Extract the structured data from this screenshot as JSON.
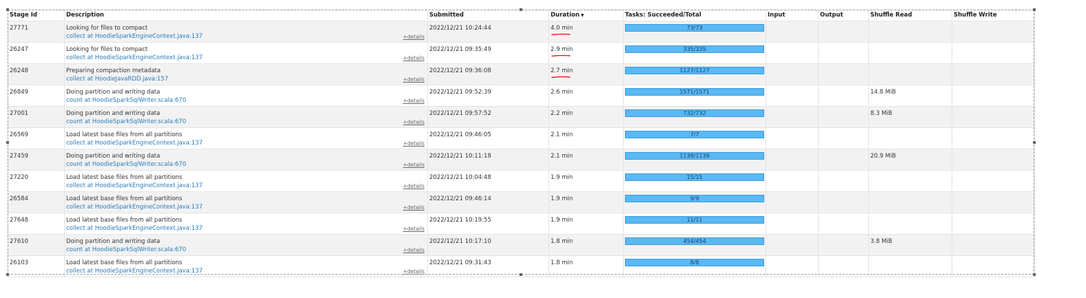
{
  "columns": {
    "stage_id": "Stage Id",
    "description": "Description",
    "submitted": "Submitted",
    "duration": "Duration",
    "duration_sort_icon": "sort-down-icon",
    "tasks": "Tasks: Succeeded/Total",
    "input": "Input",
    "output": "Output",
    "shuffle_read": "Shuffle Read",
    "shuffle_write": "Shuffle Write"
  },
  "details_label": "+details",
  "colors": {
    "link": "#2a7ab9",
    "bar": "#5ab8f5",
    "annotation": "#e02020"
  },
  "rows": [
    {
      "id": "27771",
      "desc": "Looking for files to compact",
      "link": "collect at HoodieSparkEngineContext.java:137",
      "submitted": "2022/12/21 10:24:44",
      "duration": "4.0 min",
      "tasks": "73/73",
      "tasks_fraction": 1,
      "input": "",
      "output": "",
      "shuffle_read": "",
      "shuffle_write": "",
      "underlined": true
    },
    {
      "id": "26247",
      "desc": "Looking for files to compact",
      "link": "collect at HoodieSparkEngineContext.java:137",
      "submitted": "2022/12/21 09:35:49",
      "duration": "2.9 min",
      "tasks": "335/335",
      "tasks_fraction": 1,
      "input": "",
      "output": "",
      "shuffle_read": "",
      "shuffle_write": "",
      "underlined": true
    },
    {
      "id": "26248",
      "desc": "Preparing compaction metadata",
      "link": "collect at HoodieJavaRDD.java:157",
      "submitted": "2022/12/21 09:36:08",
      "duration": "2.7 min",
      "tasks": "1127/1127",
      "tasks_fraction": 1,
      "input": "",
      "output": "",
      "shuffle_read": "",
      "shuffle_write": "",
      "underlined": true
    },
    {
      "id": "26849",
      "desc": "Doing partition and writing data",
      "link": "count at HoodieSparkSqlWriter.scala:670",
      "submitted": "2022/12/21 09:52:39",
      "duration": "2.6 min",
      "tasks": "1571/1571",
      "tasks_fraction": 1,
      "input": "",
      "output": "",
      "shuffle_read": "14.8 MiB",
      "shuffle_write": "",
      "underlined": false
    },
    {
      "id": "27001",
      "desc": "Doing partition and writing data",
      "link": "count at HoodieSparkSqlWriter.scala:670",
      "submitted": "2022/12/21 09:57:52",
      "duration": "2.2 min",
      "tasks": "732/732",
      "tasks_fraction": 1,
      "input": "",
      "output": "",
      "shuffle_read": "8.3 MiB",
      "shuffle_write": "",
      "underlined": false
    },
    {
      "id": "26569",
      "desc": "Load latest base files from all partitions",
      "link": "collect at HoodieSparkEngineContext.java:137",
      "submitted": "2022/12/21 09:46:05",
      "duration": "2.1 min",
      "tasks": "7/7",
      "tasks_fraction": 1,
      "input": "",
      "output": "",
      "shuffle_read": "",
      "shuffle_write": "",
      "underlined": false
    },
    {
      "id": "27459",
      "desc": "Doing partition and writing data",
      "link": "count at HoodieSparkSqlWriter.scala:670",
      "submitted": "2022/12/21 10:11:18",
      "duration": "2.1 min",
      "tasks": "1139/1139",
      "tasks_fraction": 1,
      "input": "",
      "output": "",
      "shuffle_read": "20.9 MiB",
      "shuffle_write": "",
      "underlined": false
    },
    {
      "id": "27220",
      "desc": "Load latest base files from all partitions",
      "link": "collect at HoodieSparkEngineContext.java:137",
      "submitted": "2022/12/21 10:04:48",
      "duration": "1.9 min",
      "tasks": "15/15",
      "tasks_fraction": 1,
      "input": "",
      "output": "",
      "shuffle_read": "",
      "shuffle_write": "",
      "underlined": false
    },
    {
      "id": "26584",
      "desc": "Load latest base files from all partitions",
      "link": "collect at HoodieSparkEngineContext.java:137",
      "submitted": "2022/12/21 09:46:14",
      "duration": "1.9 min",
      "tasks": "9/9",
      "tasks_fraction": 1,
      "input": "",
      "output": "",
      "shuffle_read": "",
      "shuffle_write": "",
      "underlined": false
    },
    {
      "id": "27648",
      "desc": "Load latest base files from all partitions",
      "link": "collect at HoodieSparkEngineContext.java:137",
      "submitted": "2022/12/21 10:19:55",
      "duration": "1.9 min",
      "tasks": "11/11",
      "tasks_fraction": 1,
      "input": "",
      "output": "",
      "shuffle_read": "",
      "shuffle_write": "",
      "underlined": false
    },
    {
      "id": "27610",
      "desc": "Doing partition and writing data",
      "link": "count at HoodieSparkSqlWriter.scala:670",
      "submitted": "2022/12/21 10:17:10",
      "duration": "1.8 min",
      "tasks": "454/454",
      "tasks_fraction": 1,
      "input": "",
      "output": "",
      "shuffle_read": "3.8 MiB",
      "shuffle_write": "",
      "underlined": false
    },
    {
      "id": "26103",
      "desc": "Load latest base files from all partitions",
      "link": "collect at HoodieSparkEngineContext.java:137",
      "submitted": "2022/12/21 09:31:43",
      "duration": "1.8 min",
      "tasks": "8/8",
      "tasks_fraction": 1,
      "input": "",
      "output": "",
      "shuffle_read": "",
      "shuffle_write": "",
      "underlined": false
    }
  ]
}
